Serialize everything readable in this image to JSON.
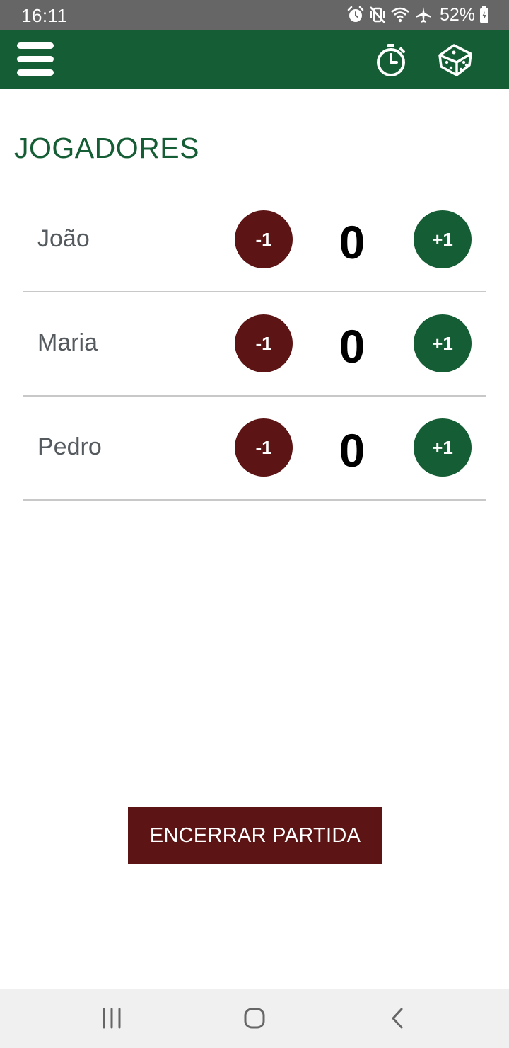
{
  "status_bar": {
    "time": "16:11",
    "battery": "52%",
    "icons": [
      "alarm-icon",
      "vibrate-mute-icon",
      "wifi-icon",
      "airplane-icon",
      "battery-icon"
    ]
  },
  "app_bar": {
    "icons": [
      "menu-icon",
      "timer-icon",
      "dice-icon"
    ],
    "color": "#155d34"
  },
  "main": {
    "section_title": "JOGADORES",
    "players": [
      {
        "name": "João",
        "score": "0",
        "minus_label": "-1",
        "plus_label": "+1"
      },
      {
        "name": "Maria",
        "score": "0",
        "minus_label": "-1",
        "plus_label": "+1"
      },
      {
        "name": "Pedro",
        "score": "0",
        "minus_label": "-1",
        "plus_label": "+1"
      }
    ],
    "end_button_label": "ENCERRAR PARTIDA"
  },
  "colors": {
    "primary_green": "#155d34",
    "dark_red": "#5c1414",
    "status_bar_gray": "#666666"
  },
  "nav_bar": {
    "icons": [
      "recent-apps-icon",
      "home-icon",
      "back-icon"
    ]
  }
}
